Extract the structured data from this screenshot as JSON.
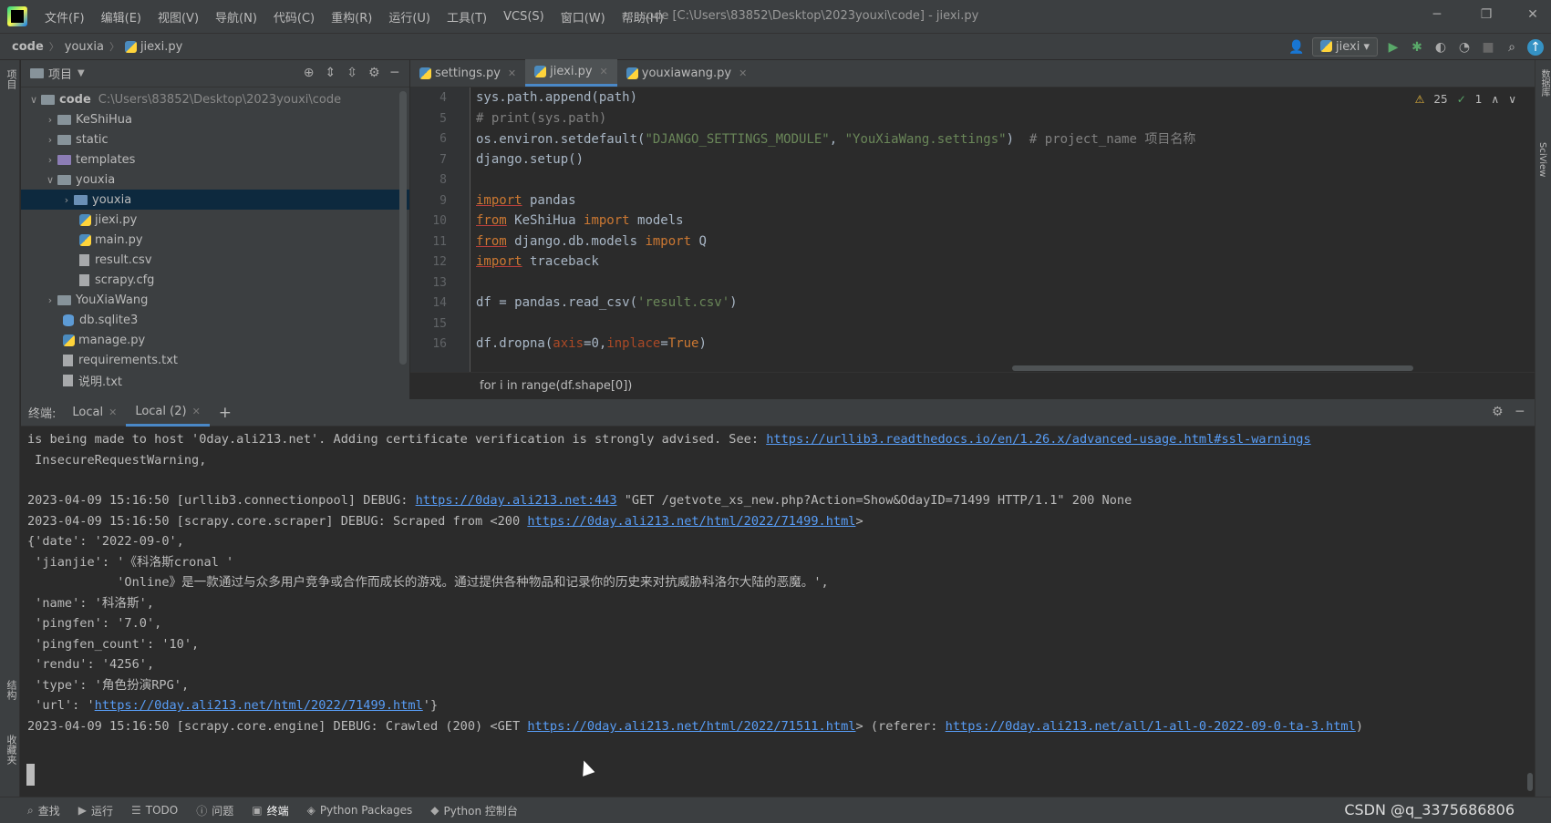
{
  "window": {
    "title": "code [C:\\Users\\83852\\Desktop\\2023youxi\\code] - jiexi.py",
    "menu": [
      "文件(F)",
      "编辑(E)",
      "视图(V)",
      "导航(N)",
      "代码(C)",
      "重构(R)",
      "运行(U)",
      "工具(T)",
      "VCS(S)",
      "窗口(W)",
      "帮助(H)"
    ]
  },
  "navbar": {
    "crumbs": [
      "code",
      "youxia",
      "jiexi.py"
    ],
    "run_config": "jiexi"
  },
  "stripes": {
    "left_top": "项目",
    "left_bottom": "结构",
    "left_bottom2": "收藏夹",
    "right_top": "数据库",
    "right_bottom": "SciView"
  },
  "project": {
    "title": "项目",
    "root": {
      "name": "code",
      "path": "C:\\Users\\83852\\Desktop\\2023youxi\\code"
    },
    "items": [
      {
        "name": "KeShiHua",
        "type": "folder"
      },
      {
        "name": "static",
        "type": "folder"
      },
      {
        "name": "templates",
        "type": "folder"
      },
      {
        "name": "youxia",
        "type": "folder-open"
      },
      {
        "name": "youxia",
        "type": "folder-selected"
      },
      {
        "name": "jiexi.py",
        "type": "py"
      },
      {
        "name": "main.py",
        "type": "py"
      },
      {
        "name": "result.csv",
        "type": "file"
      },
      {
        "name": "scrapy.cfg",
        "type": "file"
      },
      {
        "name": "YouXiaWang",
        "type": "folder"
      },
      {
        "name": "db.sqlite3",
        "type": "db"
      },
      {
        "name": "manage.py",
        "type": "py"
      },
      {
        "name": "requirements.txt",
        "type": "file"
      },
      {
        "name": "说明.txt",
        "type": "file"
      }
    ]
  },
  "editor": {
    "tabs": [
      "settings.py",
      "jiexi.py",
      "youxiawang.py"
    ],
    "active_tab": 1,
    "warnings": "25",
    "checks": "1",
    "line_numbers": [
      "4",
      "5",
      "6",
      "7",
      "8",
      "9",
      "10",
      "11",
      "12",
      "13",
      "14",
      "15",
      "16"
    ],
    "lines": {
      "l4": "sys.path.append(path)",
      "l5": "# print(sys.path)",
      "l6a": "os.environ.setdefault(",
      "l6b": "\"DJANGO_SETTINGS_MODULE\"",
      "l6c": ", ",
      "l6d": "\"YouXiaWang.settings\"",
      "l6e": ")  ",
      "l6f": "# project_name 项目名称",
      "l7": "django.setup()",
      "l9kw": "import",
      "l9": " pandas",
      "l10kw1": "from",
      "l10a": " KeShiHua ",
      "l10kw2": "import",
      "l10b": " models",
      "l11kw1": "from",
      "l11a": " django.db.models ",
      "l11kw2": "import",
      "l11b": " Q",
      "l12kw": "import",
      "l12": " traceback",
      "l14a": "df = pandas.read_csv(",
      "l14b": "'result.csv'",
      "l14c": ")",
      "l16a": "df.dropna(",
      "l16b": "axis",
      "l16c": "=0,",
      "l16d": "inplace",
      "l16e": "=",
      "l16f": "True",
      "l16g": ")"
    },
    "breadcrumb": "for i in range(df.shape[0])"
  },
  "terminal": {
    "label": "终端:",
    "tabs": [
      "Local",
      "Local (2)"
    ],
    "lines": {
      "t1a": "is being made to host '0day.ali213.net'. Adding certificate verification is strongly advised. See: ",
      "t1link": "https://urllib3.readthedocs.io/en/1.26.x/advanced-usage.html#ssl-warnings",
      "t2": " InsecureRequestWarning,",
      "t3a": "2023-04-09 15:16:50 [urllib3.connectionpool] DEBUG: ",
      "t3link": "https://0day.ali213.net:443",
      "t3b": " \"GET /getvote_xs_new.php?Action=Show&OdayID=71499 HTTP/1.1\" 200 None",
      "t4a": "2023-04-09 15:16:50 [scrapy.core.scraper] DEBUG: Scraped from <200 ",
      "t4link": "https://0day.ali213.net/html/2022/71499.html",
      "t4b": ">",
      "t5": "{'date': '2022-09-0',",
      "t6": " 'jianjie': '《科洛斯cronal '",
      "t7": "            'Online》是一款通过与众多用户竞争或合作而成长的游戏。通过提供各种物品和记录你的历史来对抗威胁科洛尔大陆的恶魔。',",
      "t8": " 'name': '科洛斯',",
      "t9": " 'pingfen': '7.0',",
      "t10": " 'pingfen_count': '10',",
      "t11": " 'rendu': '4256',",
      "t12": " 'type': '角色扮演RPG',",
      "t13a": " 'url': '",
      "t13link": "https://0day.ali213.net/html/2022/71499.html",
      "t13b": "'}",
      "t14a": "2023-04-09 15:16:50 [scrapy.core.engine] DEBUG: Crawled (200) <GET ",
      "t14link": "https://0day.ali213.net/html/2022/71511.html",
      "t14b": "> (referer: ",
      "t14link2": "https://0day.ali213.net/all/1-all-0-2022-09-0-ta-3.html",
      "t14c": ")"
    }
  },
  "bottombar": {
    "items": [
      "查找",
      "运行",
      "TODO",
      "问题",
      "终端",
      "Python Packages",
      "Python 控制台"
    ],
    "watermark": "CSDN @q_3375686806"
  }
}
